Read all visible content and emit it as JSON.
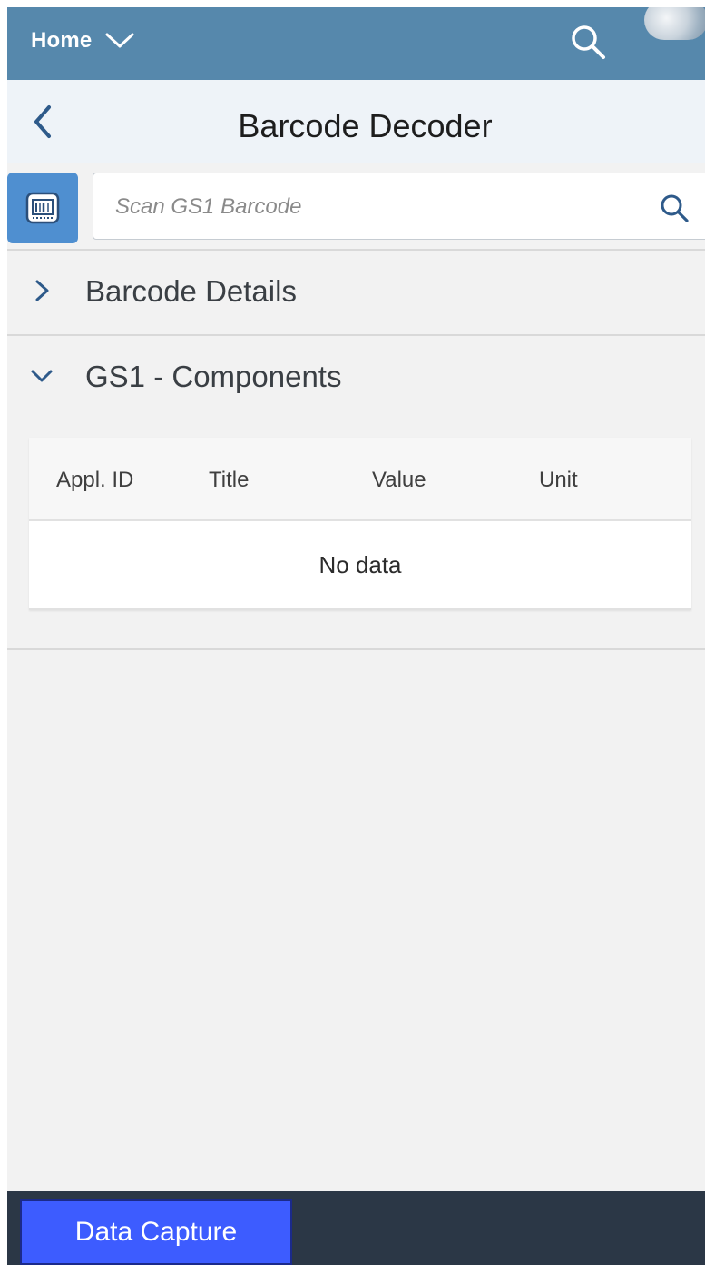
{
  "shell": {
    "home_label": "Home",
    "icons": {
      "home_menu": "chevron-down-icon",
      "search": "search-icon",
      "avatar": "avatar"
    }
  },
  "page": {
    "title": "Barcode Decoder",
    "back_icon": "chevron-left-icon"
  },
  "scan": {
    "scan_button_icon": "barcode-scan-icon",
    "placeholder": "Scan GS1 Barcode",
    "value": "",
    "search_icon": "search-icon"
  },
  "panels": [
    {
      "title": "Barcode Details",
      "expanded": false,
      "icon": "chevron-right-icon"
    },
    {
      "title": "GS1 - Components",
      "expanded": true,
      "icon": "chevron-down-icon"
    }
  ],
  "table": {
    "columns": [
      "Appl. ID",
      "Title",
      "Value",
      "Unit"
    ],
    "rows": [],
    "empty_text": "No data"
  },
  "footer": {
    "button_label": "Data Capture"
  },
  "colors": {
    "shell": "#5688ac",
    "page_header": "#eef3f8",
    "background": "#f2f2f2",
    "scan_button": "#4f8fd0",
    "footer": "#2b3746",
    "data_capture_button": "#3d5cff"
  }
}
